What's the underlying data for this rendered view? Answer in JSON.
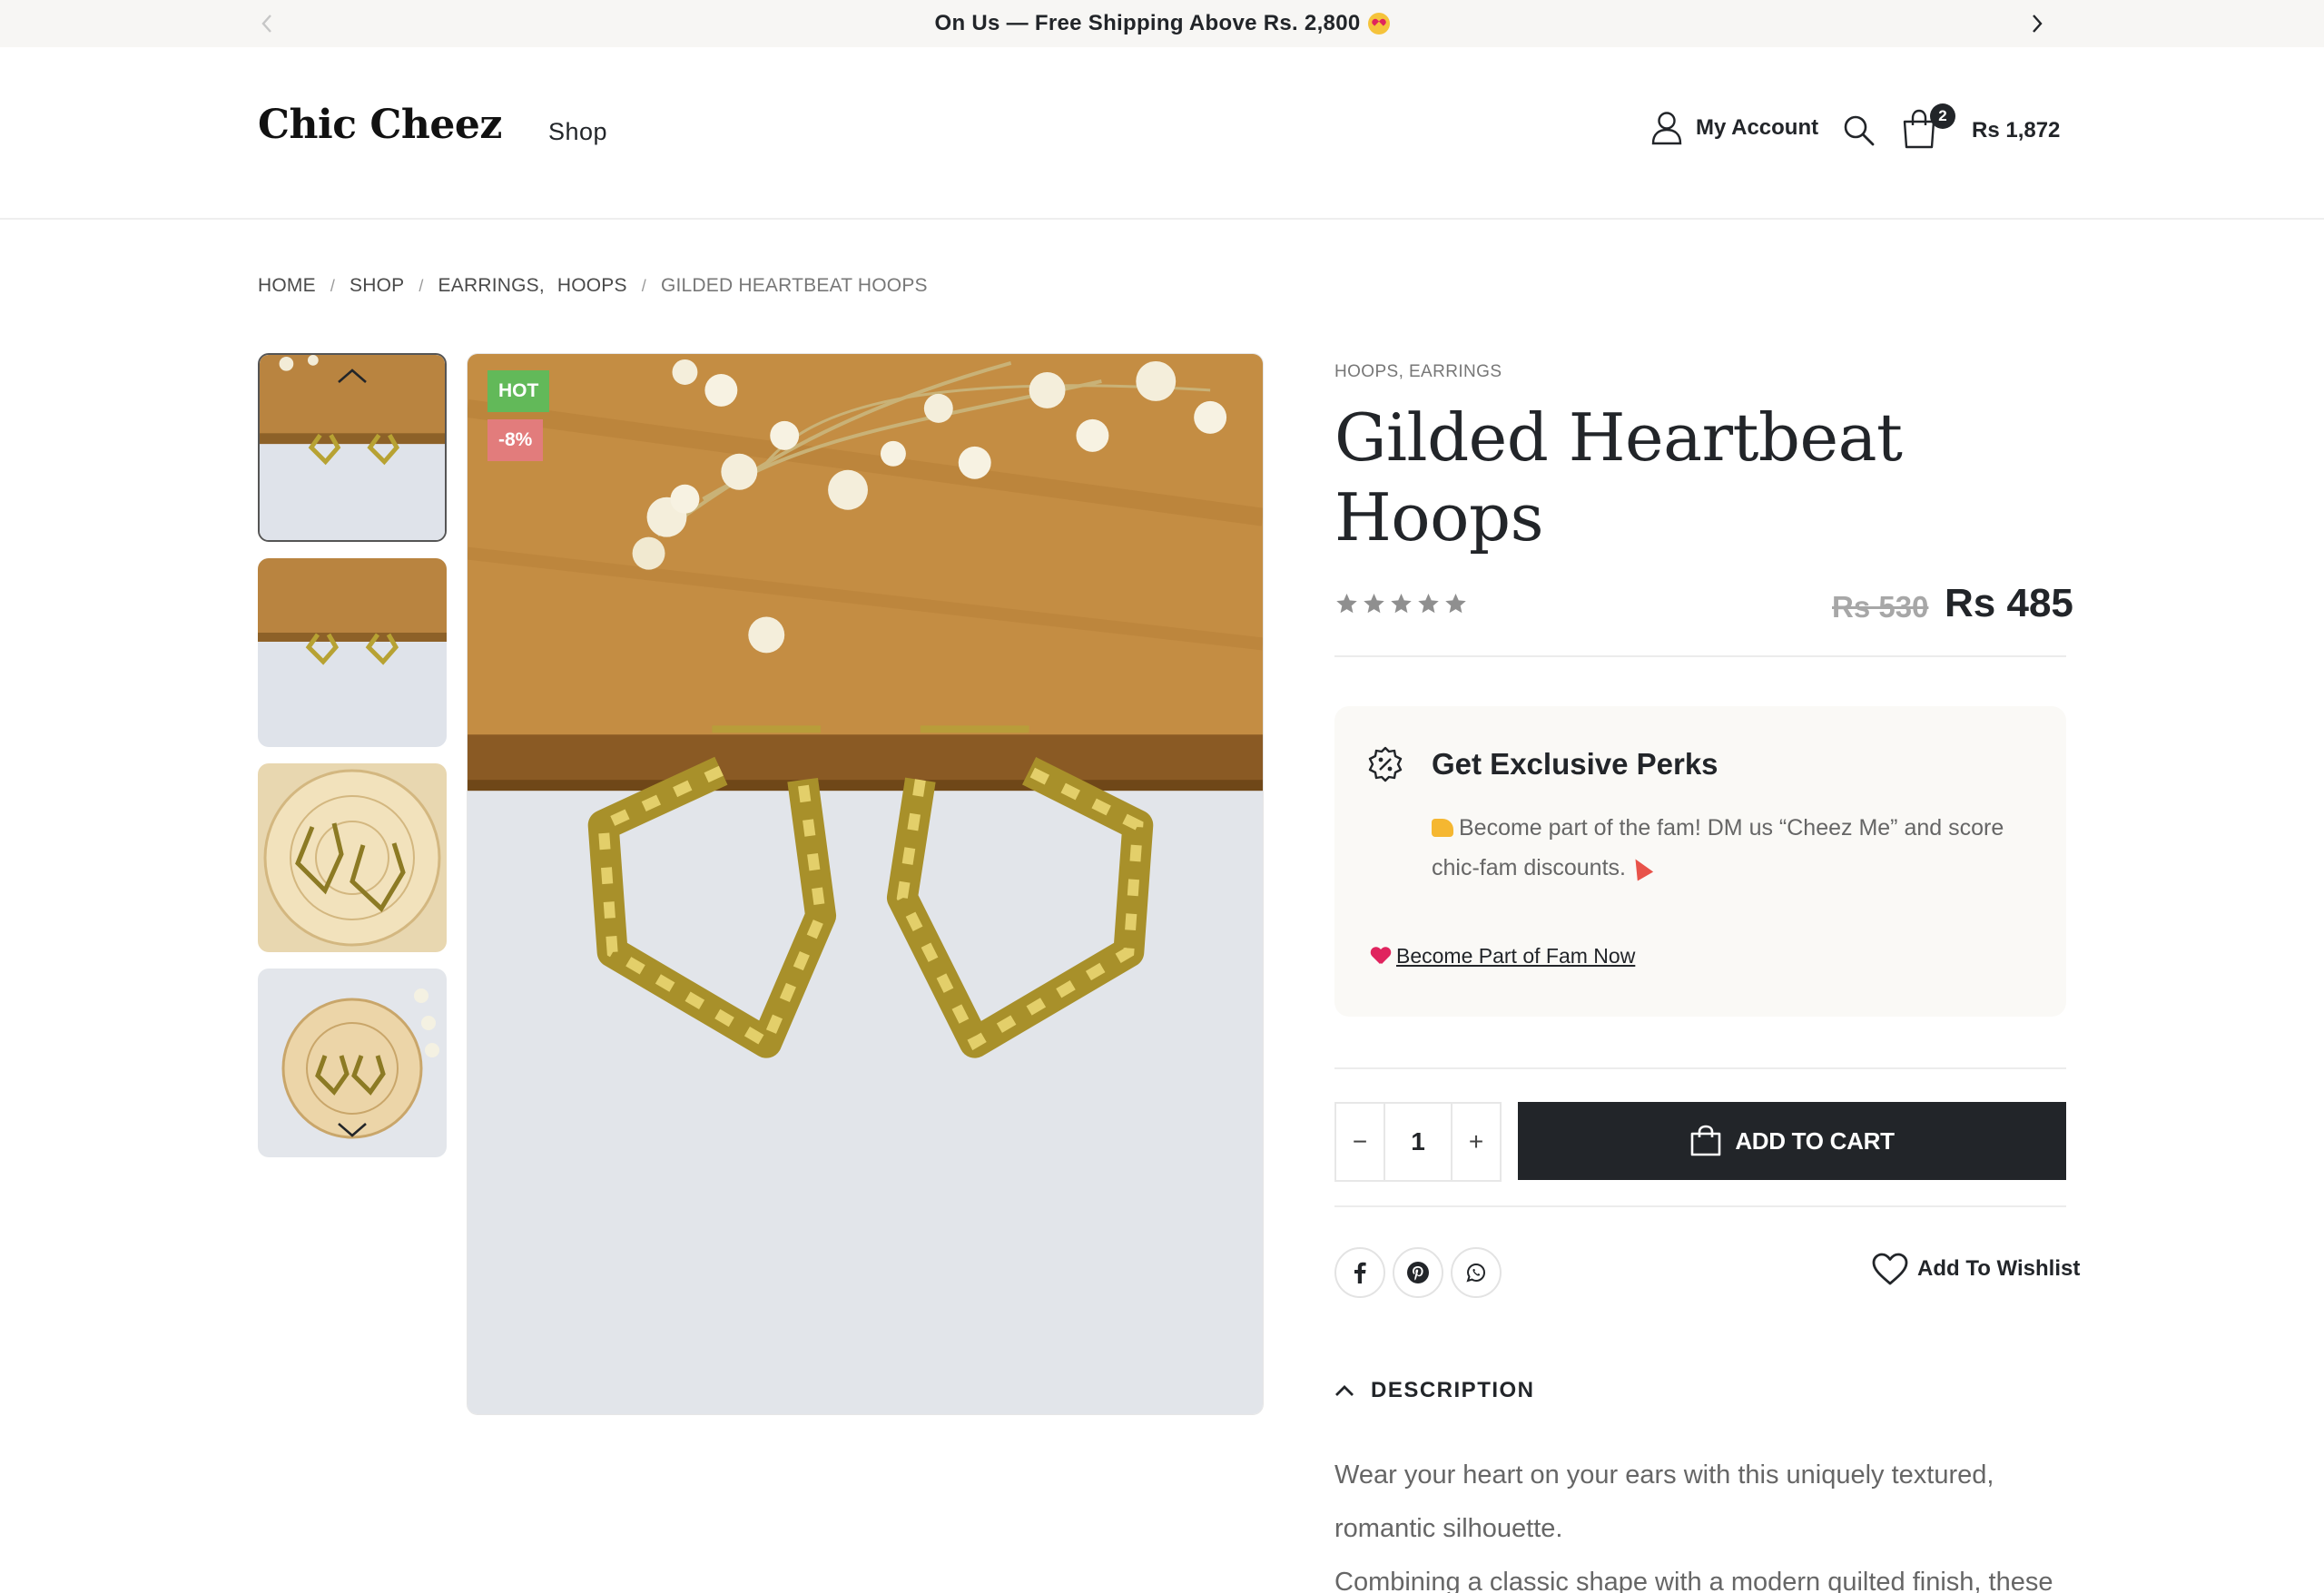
{
  "announcement": {
    "text": "On Us — Free Shipping Above Rs. 2,800"
  },
  "header": {
    "logo": "Chic Cheez",
    "nav": [
      "Shop"
    ],
    "account_label": "My Account",
    "cart_count": "2",
    "cart_total": "Rs 1,872"
  },
  "breadcrumb": {
    "items": [
      "HOME",
      "SHOP",
      "EARRINGS,",
      "HOOPS",
      "GILDED HEARTBEAT HOOPS"
    ]
  },
  "gallery": {
    "badges": {
      "hot": "HOT",
      "discount": "-8%"
    }
  },
  "product": {
    "categories": "HOOPS, EARRINGS",
    "title": "Gilded Heartbeat Hoops",
    "rating_stars": 5,
    "price_old": "Rs 530",
    "price_new": "Rs 485"
  },
  "perks": {
    "title": "Get Exclusive Perks",
    "text": "Become part of the fam! DM us “Cheez Me” and score chic-fam discounts.",
    "link": "Become Part of Fam Now"
  },
  "purchase": {
    "quantity": "1",
    "minus": "−",
    "plus": "+",
    "add_to_cart": "ADD TO CART"
  },
  "share": {
    "wishlist_label": "Add To Wishlist"
  },
  "description": {
    "heading": "DESCRIPTION",
    "paragraph_1": "Wear your heart on your ears with this uniquely textured, romantic silhouette.",
    "paragraph_2": "Combining a classic shape with a modern quilted finish, these"
  },
  "colors": {
    "dark": "#222529",
    "hot_badge": "#62b959",
    "sale_badge": "#e27c7c",
    "perks_bg": "#faf9f6"
  }
}
